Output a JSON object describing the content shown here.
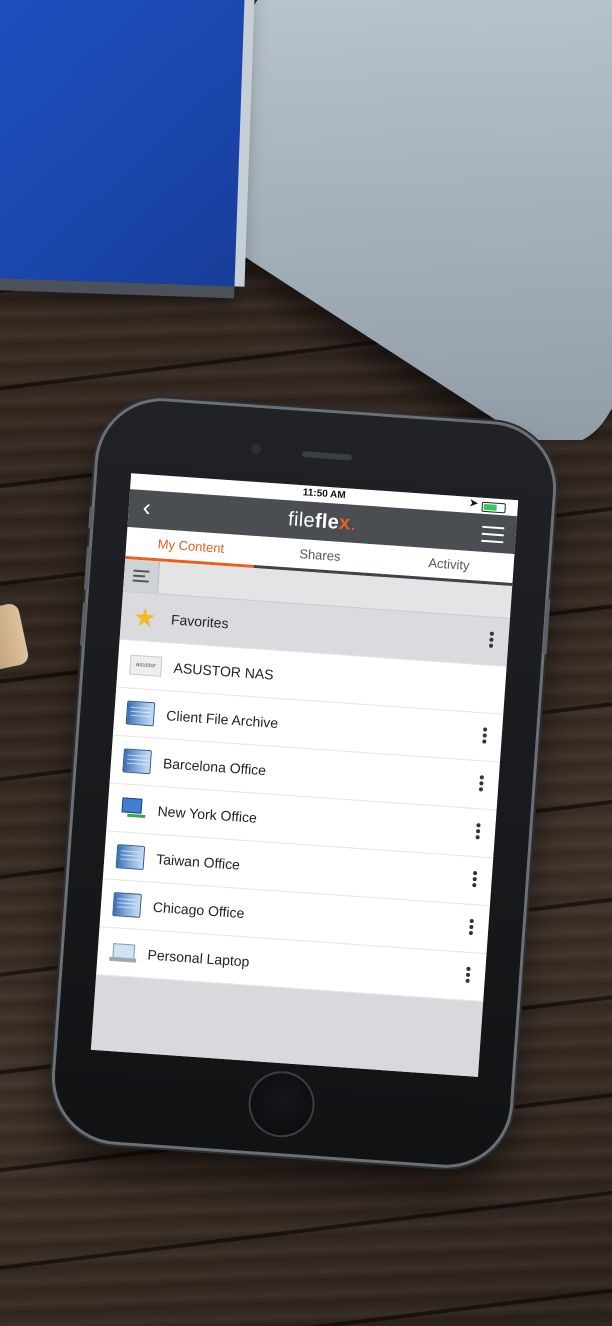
{
  "status": {
    "time": "11:50 AM"
  },
  "header": {
    "logo_plain": "file",
    "logo_bold": "fle",
    "logo_x": "x",
    "logo_dot": "."
  },
  "tabs": [
    {
      "label": "My Content",
      "active": true
    },
    {
      "label": "Shares",
      "active": false
    },
    {
      "label": "Activity",
      "active": false
    }
  ],
  "list": {
    "items": [
      {
        "label": "Favorites",
        "icon": "star-icon"
      },
      {
        "label": "ASUSTOR NAS",
        "icon": "asustor-logo-icon",
        "icon_text": "asustor"
      },
      {
        "label": "Client File Archive",
        "icon": "server-icon"
      },
      {
        "label": "Barcelona Office",
        "icon": "server-icon"
      },
      {
        "label": "New York Office",
        "icon": "network-computer-icon"
      },
      {
        "label": "Taiwan Office",
        "icon": "server-icon"
      },
      {
        "label": "Chicago Office",
        "icon": "server-icon"
      },
      {
        "label": "Personal Laptop",
        "icon": "laptop-icon"
      }
    ]
  },
  "colors": {
    "accent": "#e8601c",
    "appbar": "#4a4d52",
    "star": "#f5b921"
  }
}
